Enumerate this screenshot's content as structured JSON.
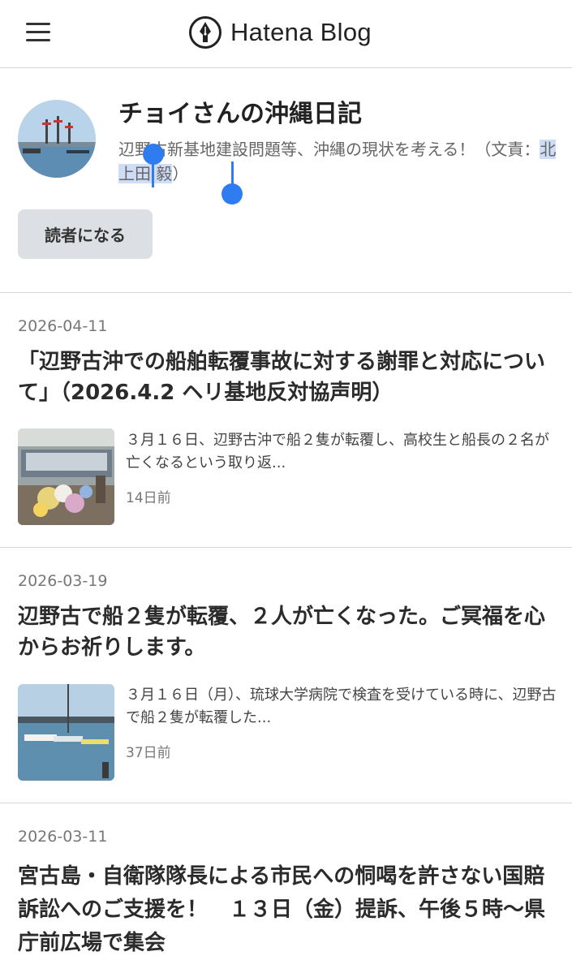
{
  "header": {
    "menu_icon": "hamburger-menu-icon",
    "logo_icon": "hatena-pen-icon",
    "logo_text": "Hatena Blog"
  },
  "blog": {
    "title": "チョイさんの沖縄日記",
    "description_before": "辺野古新基地建設問題等、沖縄の現状を考える！（文責：",
    "description_selected": "北上田 毅",
    "description_after": "）",
    "follow_label": "読者になる",
    "selection_color": "#2f7cf0"
  },
  "entries": [
    {
      "date": "2026-04-11",
      "title": "「辺野古沖での船舶転覆事故に対する謝罪と対応について」（2026.4.2 ヘリ基地反対協声明）",
      "summary": "３月１６日、辺野古沖で船２隻が転覆し、高校生と船長の２名が亡くなるという取り返...",
      "ago": "14日前",
      "thumbnail": "memorial-flowers-photo"
    },
    {
      "date": "2026-03-19",
      "title": "辺野古で船２隻が転覆、２人が亡くなった。ご冥福を心からお祈りします。",
      "summary": "３月１６日（月）、琉球大学病院で検査を受けている時に、辺野古で船２隻が転覆した...",
      "ago": "37日前",
      "thumbnail": "boats-in-harbor-photo"
    },
    {
      "date": "2026-03-11",
      "title": "宮古島・自衛隊隊長による市民への恫喝を許さない国賠訴訟へのご支援を！　１３日（金）提訴、午後５時～県庁前広場で集会"
    }
  ]
}
